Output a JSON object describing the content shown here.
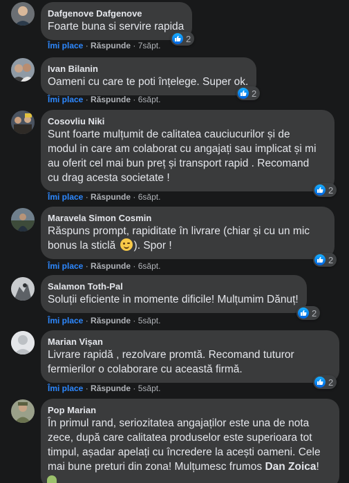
{
  "actions": {
    "like": "Îmi place",
    "reply": "Răspunde",
    "sep": "·"
  },
  "comments": [
    {
      "author": "Dafgenove Dafgenove",
      "lines": [
        "Foarte buna si servire rapida"
      ],
      "time": "7săpt.",
      "reactions": "2"
    },
    {
      "author": "Ivan Bilanin",
      "lines": [
        "Oameni cu care te poti înțelege. Super ok."
      ],
      "time": "6săpt.",
      "reactions": "2"
    },
    {
      "author": "Cosovliu Niki",
      "lines": [
        "Sunt foarte mulțumit de calitatea cauciucurilor și de",
        "modul in care am colaborat cu angajați sau implicat și mi",
        "au oferit cel mai bun preț și transport rapid . Recomand",
        "cu drag acesta societate !"
      ],
      "time": "6săpt.",
      "reactions": "2"
    },
    {
      "author": "Maravela Simon Cosmin",
      "lines": [
        "Răspuns prompt, rapiditate în livrare (chiar și cu un mic",
        "bonus la sticlă",
        "). Spor !"
      ],
      "emoji": "winking-face",
      "time": "6săpt.",
      "reactions": "2"
    },
    {
      "author": "Salamon Toth-Pal",
      "lines": [
        "Soluții eficiente in momente dificile! Mulțumim Dănuț!"
      ],
      "time": "5săpt.",
      "reactions": "2"
    },
    {
      "author": "Marian Vișan",
      "lines": [
        "Livrare rapidă , rezolvare promtă. Recomand tuturor",
        "fermierilor o colaborare cu această firmă."
      ],
      "time": "5săpt.",
      "reactions": "2"
    },
    {
      "author": "Pop Marian",
      "lines": [
        "În primul rand, seriozitatea angajaților este una de nota",
        "zece, după care calitatea produselor este superioara tot",
        "timpul, așadar apelați cu încredere la acești oameni. Cele",
        "mai bune preturi din zona! Mulțumesc frumos",
        "Dan Zoica",
        "!"
      ]
    }
  ],
  "colors": {
    "background": "#18191a",
    "bubble": "#3a3b3c",
    "like_blue": "#2d88ff",
    "muted": "#b0b3b8"
  }
}
